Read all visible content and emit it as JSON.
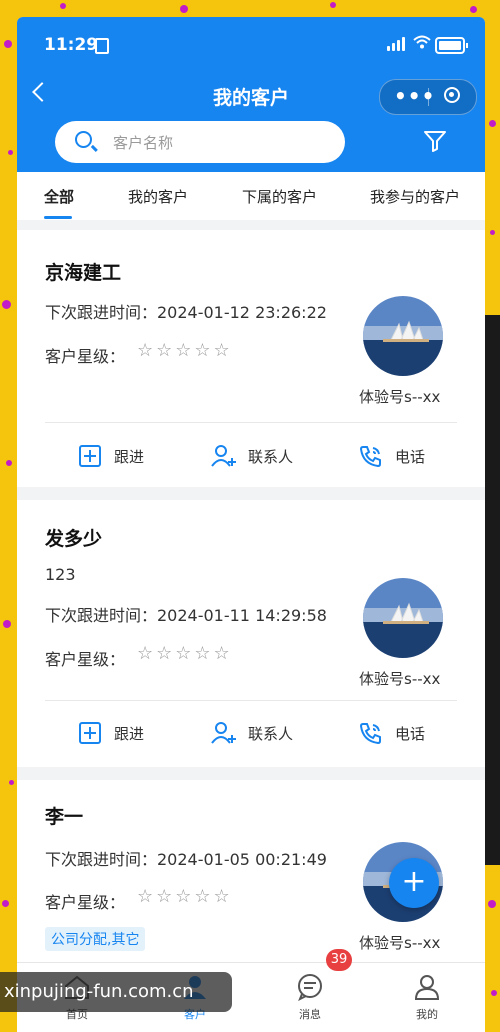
{
  "status_bar": {
    "time": "11:29"
  },
  "nav": {
    "title": "我的客户"
  },
  "search": {
    "placeholder": "客户名称"
  },
  "tabs": [
    {
      "label": "全部",
      "active": true
    },
    {
      "label": "我的客户",
      "active": false
    },
    {
      "label": "下属的客户",
      "active": false
    },
    {
      "label": "我参与的客户",
      "active": false
    }
  ],
  "customers": [
    {
      "name": "京海建工",
      "next_followup": "下次跟进时间：2024-01-12 23:26:22",
      "star_label": "客户星级：",
      "stars": "☆☆☆☆☆",
      "owner": "体验号s--xx"
    },
    {
      "name": "发多少",
      "note": "123",
      "next_followup": "下次跟进时间：2024-01-11 14:29:58",
      "star_label": "客户星级：",
      "stars": "☆☆☆☆☆",
      "owner": "体验号s--xx"
    },
    {
      "name": "李一",
      "next_followup": "下次跟进时间：2024-01-05 00:21:49",
      "star_label": "客户星级：",
      "stars": "☆☆☆☆☆",
      "tag": "公司分配,其它",
      "owner": "体验号s--xx"
    }
  ],
  "actions": {
    "follow": "跟进",
    "contact": "联系人",
    "phone": "电话"
  },
  "tabbar": {
    "home": "首页",
    "customers": "客户",
    "messages": "消息",
    "messages_badge": "39",
    "mine": "我的"
  },
  "fab": "+",
  "watermark": "xinpujing-fun.com.cn",
  "colors": {
    "primary": "#1785f0",
    "background_frame": "#f5c40c",
    "dots": "#c21cc9"
  }
}
